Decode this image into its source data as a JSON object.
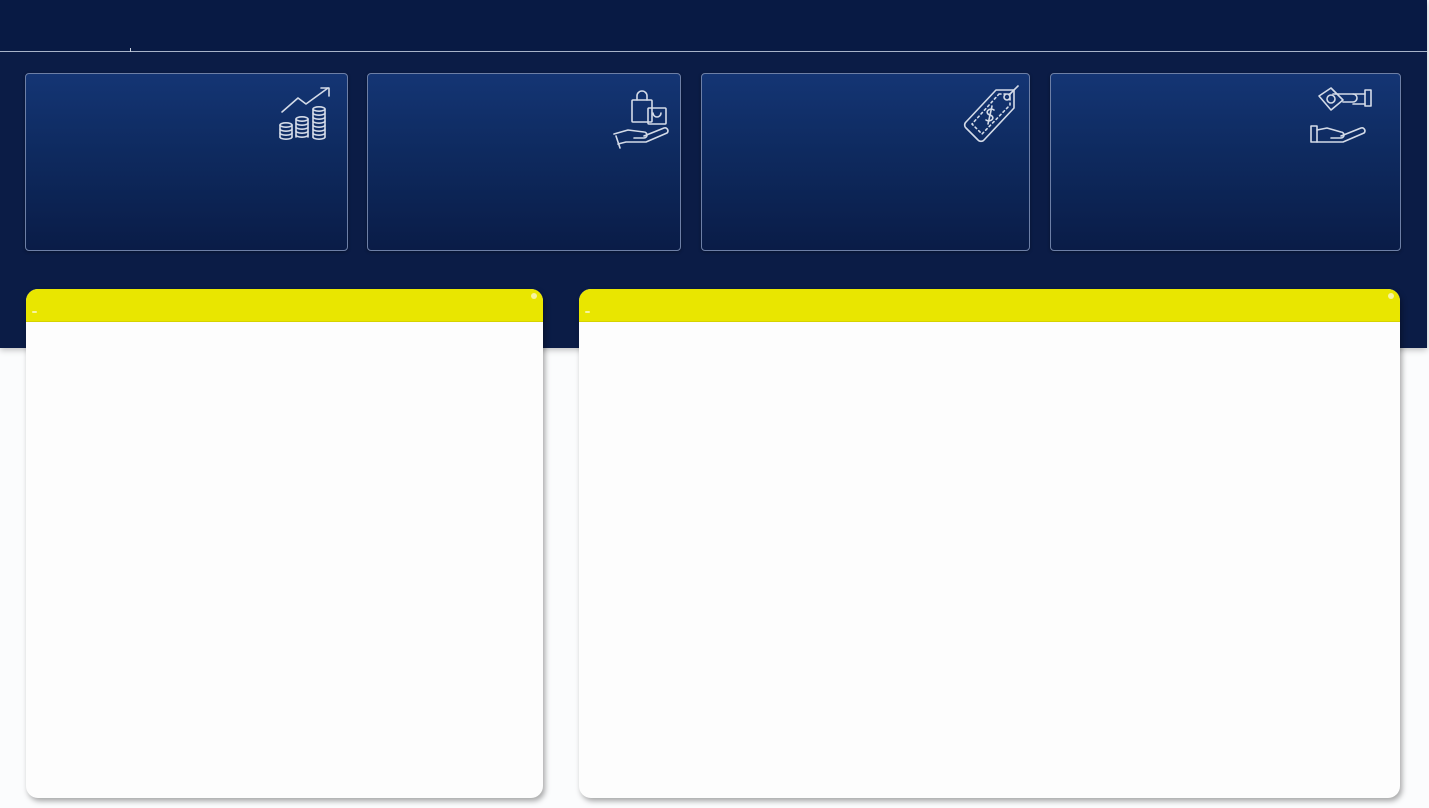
{
  "header": {
    "title": ""
  },
  "kpis": [
    {
      "label": "",
      "value": "",
      "icon": "growth-coins-icon"
    },
    {
      "label": "",
      "value": "",
      "icon": "shopping-bag-hand-icon"
    },
    {
      "label": "",
      "value": "",
      "icon": "price-tag-icon"
    },
    {
      "label": "",
      "value": "",
      "icon": "money-handshake-icon"
    }
  ],
  "panels": [
    {
      "title": ""
    },
    {
      "title": ""
    }
  ],
  "colors": {
    "navy": "#0b1c46",
    "card_top": "#143574",
    "card_bottom": "#0a1c47",
    "accent_yellow": "#e9e600",
    "panel_bg": "#fdfdfd",
    "icon_stroke": "#d4dbe8"
  }
}
